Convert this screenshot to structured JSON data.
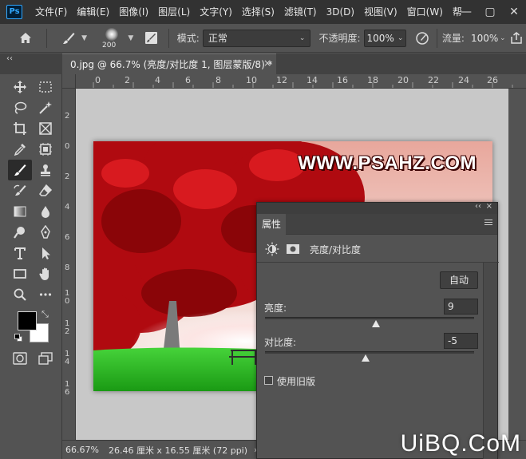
{
  "app": {
    "logo_text": "Ps",
    "menu": [
      "文件(F)",
      "编辑(E)",
      "图像(I)",
      "图层(L)",
      "文字(Y)",
      "选择(S)",
      "滤镜(T)",
      "3D(D)",
      "视图(V)",
      "窗口(W)",
      "帮"
    ],
    "window_controls": [
      "—",
      "▢",
      "✕"
    ]
  },
  "options": {
    "brush_size": "200",
    "mode_label": "模式:",
    "mode_value": "正常",
    "opacity_label": "不透明度:",
    "opacity_value": "100%",
    "flow_label": "流量:",
    "flow_value": "100%"
  },
  "document": {
    "tab_title": "0.jpg @ 66.7% (亮度/对比度 1, 图层蒙版/8) *",
    "close": "×",
    "collapse": "‹‹"
  },
  "rulers": {
    "top": [
      "0",
      "2",
      "4",
      "6",
      "8",
      "10",
      "12",
      "14",
      "16",
      "18",
      "20",
      "22",
      "24",
      "26"
    ],
    "left": [
      "2",
      "0",
      "2",
      "4",
      "6",
      "8",
      "1\n0",
      "1\n2",
      "1\n4",
      "1\n6"
    ]
  },
  "image": {
    "watermark": "WWW.PSAHZ.COM"
  },
  "status": {
    "zoom": "66.67%",
    "doc_info": "26.46 厘米 x 16.55 厘米 (72 ppi)",
    "arrow": "›"
  },
  "properties": {
    "collapse": "‹‹",
    "close": "×",
    "tab": "属性",
    "title": "亮度/对比度",
    "auto_button": "自动",
    "brightness_label": "亮度:",
    "brightness_value": "9",
    "brightness_fraction": 0.53,
    "contrast_label": "对比度:",
    "contrast_value": "-5",
    "contrast_fraction": 0.48,
    "legacy_label": "使用旧版"
  },
  "corner_watermark": "UiBQ.CoM",
  "colors": {
    "foreground": "#000000",
    "background": "#ffffff",
    "ui_dark": "#323232",
    "ui_panel": "#535353"
  }
}
